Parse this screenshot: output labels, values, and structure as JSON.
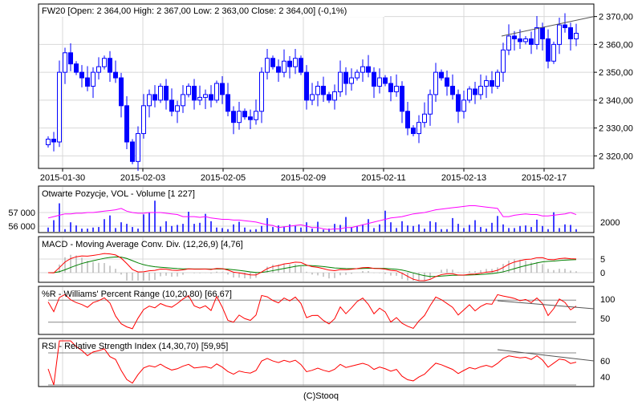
{
  "footer": "(C)Stooq",
  "chart_data": [
    {
      "type": "candlestick",
      "title": "FW20 [Open: 2 364,00  High: 2 367,00  Low: 2 363,00  Close: 2 364,00] (-0,1%)",
      "x_tick_labels": [
        "2015-01-30",
        "2015-02-03",
        "2015-02-05",
        "2015-02-09",
        "2015-02-11",
        "2015-02-13",
        "2015-02-17"
      ],
      "y_tick_labels": [
        "2 370,00",
        "2 360,00",
        "2 350,00",
        "2 340,00",
        "2 330,00",
        "2 320,00"
      ],
      "y_ticks": [
        2370,
        2360,
        2350,
        2340,
        2330,
        2320
      ],
      "ylim": [
        2315.5,
        2374.5
      ],
      "close": [
        2326,
        2325,
        2350,
        2357,
        2353,
        2350,
        2348,
        2345,
        2350,
        2352,
        2355,
        2350,
        2348,
        2338,
        2325,
        2318,
        2328,
        2338,
        2342,
        2340,
        2345,
        2340,
        2336,
        2338,
        2342,
        2345,
        2340,
        2341,
        2342,
        2340,
        2346,
        2342,
        2336,
        2332,
        2336,
        2334,
        2333,
        2336,
        2350,
        2355,
        2352,
        2350,
        2354,
        2352,
        2355,
        2350,
        2340,
        2342,
        2345,
        2342,
        2340,
        2343,
        2350,
        2346,
        2348,
        2350,
        2352,
        2350,
        2345,
        2348,
        2346,
        2343,
        2345,
        2336,
        2330,
        2328,
        2332,
        2335,
        2342,
        2350,
        2348,
        2345,
        2342,
        2336,
        2340,
        2344,
        2342,
        2345,
        2347,
        2345,
        2350,
        2358,
        2363,
        2362,
        2361,
        2362,
        2360,
        2366,
        2362,
        2354,
        2360,
        2367,
        2366,
        2362,
        2364
      ],
      "first_open": 2324,
      "trendline": [
        2363,
        2370
      ]
    },
    {
      "type": "bar+line",
      "title": "Otwarte Pozycje, VOL - Volume [1 227]",
      "left_tick_labels": [
        "57 000",
        "56 000"
      ],
      "right_tick_labels": [
        "2000"
      ],
      "open_interest": [
        56600,
        56700,
        56800,
        56900,
        56900,
        56950,
        56950,
        57000,
        57000,
        57050,
        57100,
        57150,
        57200,
        57300,
        57100,
        57000,
        56950,
        56950,
        57000,
        57000,
        57000,
        56950,
        56900,
        56850,
        56700,
        56700,
        56700,
        56650,
        56700,
        56600,
        56550,
        56500,
        56500,
        56450,
        56450,
        56400,
        56350,
        56300,
        56200,
        56100,
        56050,
        55900,
        55950,
        56000,
        56050,
        56100,
        56000,
        55900,
        55900,
        55800,
        55750,
        55800,
        55800,
        55900,
        55900,
        56000,
        56100,
        56200,
        56300,
        56400,
        56500,
        56600,
        56650,
        56700,
        56800,
        56900,
        56950,
        57000,
        57100,
        57200,
        57250,
        57300,
        57350,
        57400,
        57450,
        57500,
        57500,
        57450,
        57400,
        57350,
        57300,
        56700,
        56700,
        56800,
        56850,
        56900,
        56850,
        56850,
        56750,
        56750,
        56800,
        56850,
        56900,
        57000,
        56850
      ],
      "volume": [
        800,
        2200,
        5400,
        500,
        1800,
        1200,
        600,
        600,
        800,
        900,
        2400,
        3100,
        700,
        1800,
        1500,
        900,
        600,
        3300,
        3600,
        5900,
        1000,
        2000,
        1100,
        1300,
        1500,
        3800,
        1500,
        1700,
        3400,
        2000,
        800,
        700,
        500,
        1400,
        1900,
        800,
        400,
        500,
        1100,
        2600,
        900,
        1200,
        1000,
        1400,
        1100,
        800,
        1800,
        600,
        1900,
        400,
        600,
        1500,
        1300,
        2800,
        900,
        1100,
        1400,
        2400,
        700,
        1400,
        4000,
        1800,
        700,
        2000,
        1200,
        1100,
        1400,
        600,
        2000,
        1800,
        500,
        500,
        2600,
        1500,
        700,
        1300,
        2200,
        900,
        600,
        1700,
        3000,
        1400,
        700,
        700,
        1100,
        1200,
        900,
        2300,
        1100,
        500,
        3700,
        700,
        1400,
        1300,
        500
      ],
      "vol_max": 7000,
      "oi_range": [
        55700,
        57600
      ]
    },
    {
      "type": "line",
      "title": "MACD - Moving Average Conv. Div. (12,26,9) [4,76]",
      "y_tick_labels": [
        "5",
        "0"
      ],
      "params": [
        12,
        26,
        9
      ],
      "series": [
        "MACD",
        "Signal",
        "Histogram"
      ]
    },
    {
      "type": "line",
      "title": "%R - Williams' Percent Range (10,20,80) [66,67]",
      "y_tick_labels": [
        "100",
        "50"
      ],
      "levels": [
        20,
        80
      ],
      "period": 10
    },
    {
      "type": "line",
      "title": "RSI - Relative Strength Index (14,30,70) [59,95]",
      "y_tick_labels": [
        "60",
        "40"
      ],
      "levels": [
        30,
        70
      ],
      "period": 14
    }
  ],
  "colors": {
    "candle": "#0000ff",
    "oi": "#ff00ff",
    "indicator": "#ff0000",
    "signal": "#008000",
    "hist": "#999999"
  }
}
